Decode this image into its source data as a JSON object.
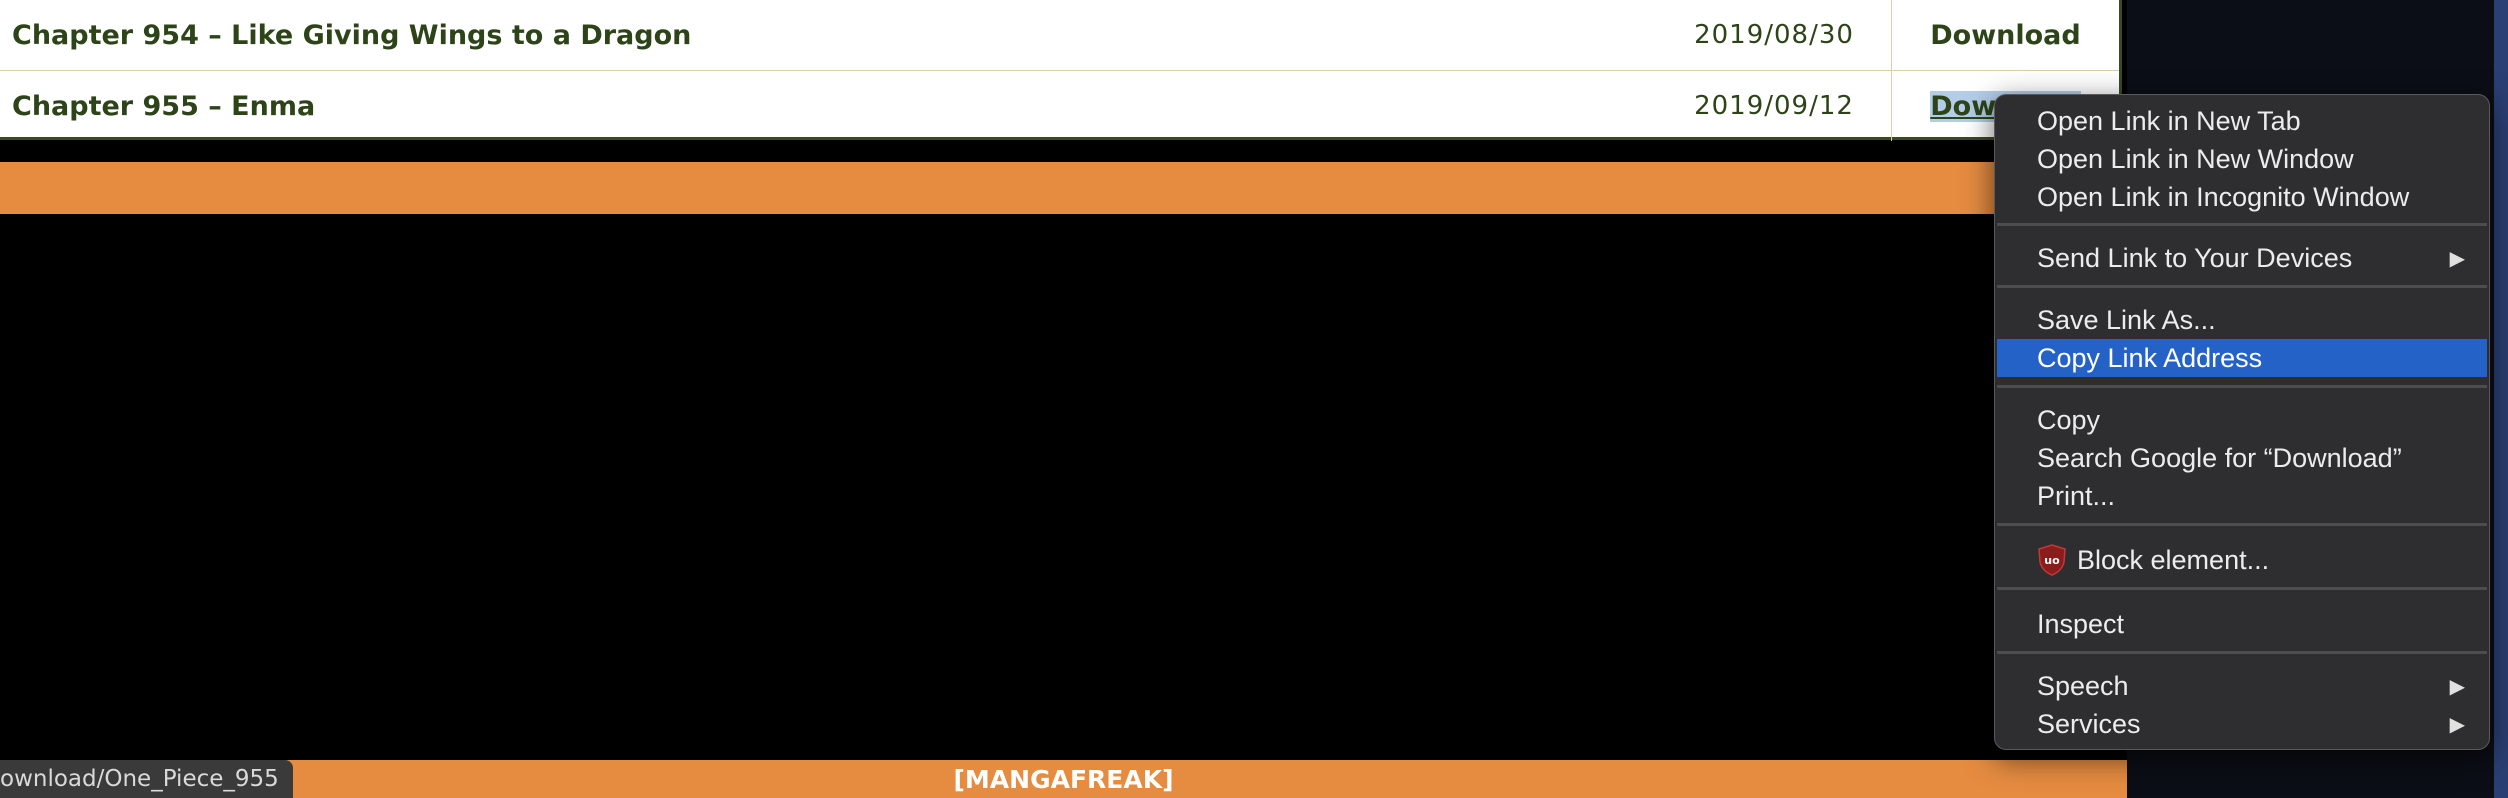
{
  "chapters": [
    {
      "title": "Chapter 954 – Like Giving Wings to a Dragon",
      "date": "2019/08/30",
      "download": "Download"
    },
    {
      "title": "Chapter 955 – Enma",
      "date": "2019/09/12",
      "download": "Download"
    }
  ],
  "footer": {
    "brand": "[MANGAFREAK]"
  },
  "status_bar": {
    "url": "ownload/One_Piece_955"
  },
  "context_menu": {
    "items": [
      {
        "label": "Open Link in New Tab"
      },
      {
        "label": "Open Link in New Window"
      },
      {
        "label": "Open Link in Incognito Window"
      },
      {
        "label": "Send Link to Your Devices"
      },
      {
        "label": "Save Link As..."
      },
      {
        "label": "Copy Link Address"
      },
      {
        "label": "Copy"
      },
      {
        "label": "Search Google for “Download”"
      },
      {
        "label": "Print..."
      },
      {
        "label": "Block element..."
      },
      {
        "label": "Inspect"
      },
      {
        "label": "Speech"
      },
      {
        "label": "Services"
      }
    ],
    "highlighted": "Copy Link Address"
  },
  "colors": {
    "accent": "#2462c8",
    "orange": "#e58c41",
    "text_green": "#2d4419"
  }
}
